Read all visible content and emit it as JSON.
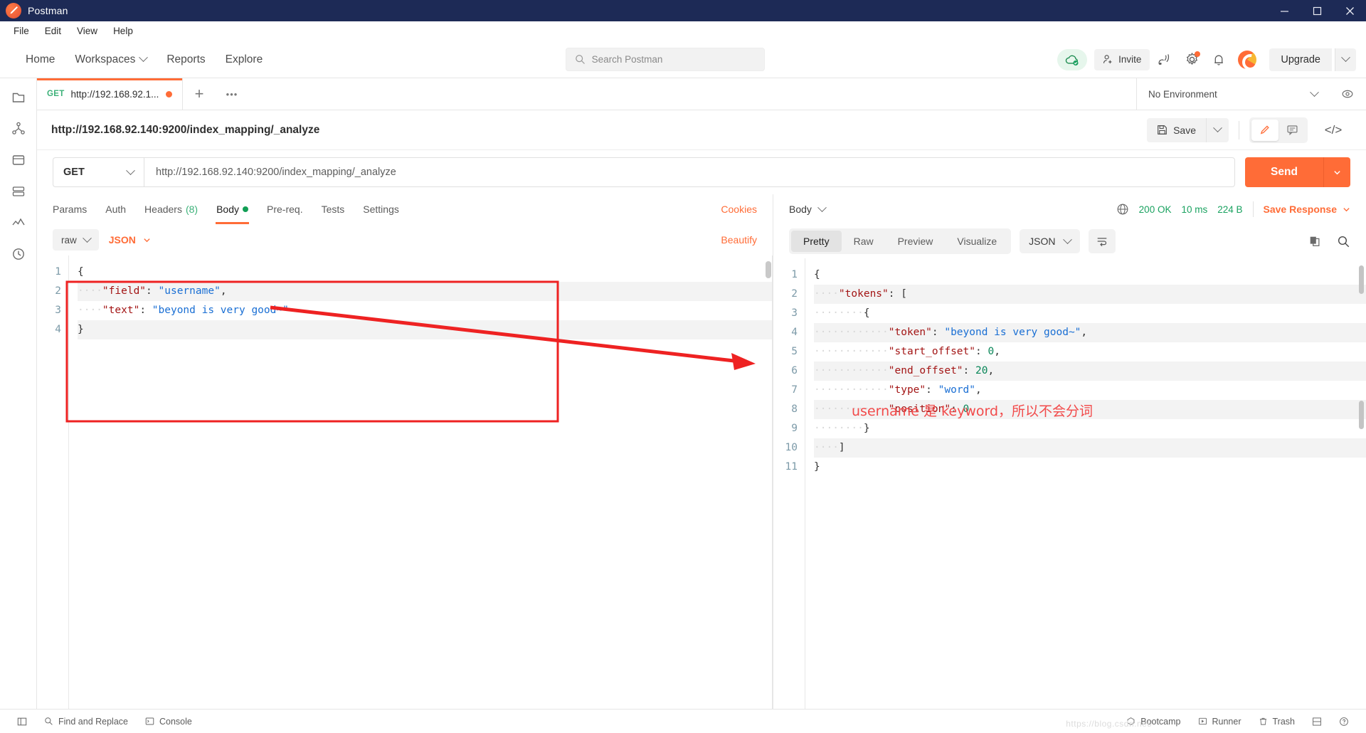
{
  "window": {
    "app_title": "Postman",
    "logo_icon": "postman-logo-icon",
    "minimize_label": "–",
    "maximize_label": "❐",
    "close_label": "✕"
  },
  "menubar": {
    "items": [
      "File",
      "Edit",
      "View",
      "Help"
    ]
  },
  "topnav": {
    "items": [
      {
        "label": "Home",
        "has_caret": false
      },
      {
        "label": "Workspaces",
        "has_caret": true
      },
      {
        "label": "Reports",
        "has_caret": false
      },
      {
        "label": "Explore",
        "has_caret": false
      }
    ],
    "search": {
      "placeholder": "Search Postman",
      "icon": "search-icon"
    },
    "cloud_icon": "cloud-sync-ok-icon",
    "invite_label": "Invite",
    "invite_icon": "person-add-icon",
    "satellite_icon": "satellite-antenna-icon",
    "settings_icon": "gear-icon",
    "notifications_icon": "bell-icon",
    "avatar_icon": "user-avatar-icon",
    "upgrade_label": "Upgrade",
    "upgrade_caret": "chevron-down-icon"
  },
  "rail": {
    "items": [
      "collections-icon",
      "apis-icon",
      "environments-icon",
      "mock-servers-icon",
      "monitors-icon",
      "history-icon"
    ]
  },
  "tabstrip": {
    "tabs": [
      {
        "method": "GET",
        "name": "http://192.168.92.1...",
        "unsaved": true
      }
    ],
    "add_label": "+",
    "more_label": "•••",
    "environment": {
      "value": "No Environment",
      "caret": "chevron-down-icon",
      "eye_icon": "eye-icon"
    }
  },
  "request_header": {
    "title": "http://192.168.92.140:9200/index_mapping/_analyze",
    "save_label": "Save",
    "save_icon": "floppy-disk-icon",
    "save_caret": "chevron-down-icon",
    "edit_icon": "pencil-icon",
    "comment_icon": "comment-icon",
    "code_icon": "code-brackets-icon"
  },
  "url_row": {
    "method": "GET",
    "method_caret": "chevron-down-icon",
    "url": "http://192.168.92.140:9200/index_mapping/_analyze",
    "send_label": "Send",
    "send_caret": "chevron-down-icon"
  },
  "request_tabs": {
    "tabs": [
      {
        "label": "Params",
        "active": false
      },
      {
        "label": "Auth",
        "active": false
      },
      {
        "label": "Headers",
        "count": "(8)",
        "active": false
      },
      {
        "label": "Body",
        "dot": true,
        "active": true
      },
      {
        "label": "Pre-req.",
        "active": false
      },
      {
        "label": "Tests",
        "active": false
      },
      {
        "label": "Settings",
        "active": false
      }
    ],
    "cookies_label": "Cookies"
  },
  "body_bar": {
    "mode": "raw",
    "mode_caret": "chevron-down-icon",
    "format": "JSON",
    "format_caret": "chevron-down-icon",
    "beautify_label": "Beautify"
  },
  "request_body": {
    "line_numbers": [
      "1",
      "2",
      "3",
      "4"
    ],
    "lines": [
      [
        {
          "t": "{",
          "c": "p"
        }
      ],
      [
        {
          "t": "····",
          "c": "ind"
        },
        {
          "t": "\"field\"",
          "c": "k"
        },
        {
          "t": ": ",
          "c": "p"
        },
        {
          "t": "\"username\"",
          "c": "s"
        },
        {
          "t": ",",
          "c": "p"
        }
      ],
      [
        {
          "t": "····",
          "c": "ind"
        },
        {
          "t": "\"text\"",
          "c": "k"
        },
        {
          "t": ": ",
          "c": "p"
        },
        {
          "t": "\"beyond is very good~\"",
          "c": "s"
        }
      ],
      [
        {
          "t": "}",
          "c": "p"
        }
      ]
    ]
  },
  "response_header": {
    "body_label": "Body",
    "body_caret": "chevron-down-icon",
    "globe_icon": "globe-icon",
    "status": "200 OK",
    "time": "10 ms",
    "size": "224 B",
    "save_response_label": "Save Response",
    "save_response_caret": "chevron-down-icon"
  },
  "response_tabs": {
    "pills": [
      {
        "label": "Pretty",
        "active": true
      },
      {
        "label": "Raw",
        "active": false
      },
      {
        "label": "Preview",
        "active": false
      },
      {
        "label": "Visualize",
        "active": false
      }
    ],
    "format": "JSON",
    "format_caret": "chevron-down-icon",
    "wrap_icon": "word-wrap-icon",
    "copy_icon": "copy-icon",
    "search_icon": "search-icon"
  },
  "response_body": {
    "line_numbers": [
      "1",
      "2",
      "3",
      "4",
      "5",
      "6",
      "7",
      "8",
      "9",
      "10",
      "11"
    ],
    "lines": [
      [
        {
          "t": "{",
          "c": "p"
        }
      ],
      [
        {
          "t": "····",
          "c": "ind"
        },
        {
          "t": "\"tokens\"",
          "c": "k"
        },
        {
          "t": ": [",
          "c": "p"
        }
      ],
      [
        {
          "t": "········",
          "c": "ind"
        },
        {
          "t": "{",
          "c": "p"
        }
      ],
      [
        {
          "t": "············",
          "c": "ind"
        },
        {
          "t": "\"token\"",
          "c": "k"
        },
        {
          "t": ": ",
          "c": "p"
        },
        {
          "t": "\"beyond is very good~\"",
          "c": "s"
        },
        {
          "t": ",",
          "c": "p"
        }
      ],
      [
        {
          "t": "············",
          "c": "ind"
        },
        {
          "t": "\"start_offset\"",
          "c": "k"
        },
        {
          "t": ": ",
          "c": "p"
        },
        {
          "t": "0",
          "c": "n"
        },
        {
          "t": ",",
          "c": "p"
        }
      ],
      [
        {
          "t": "············",
          "c": "ind"
        },
        {
          "t": "\"end_offset\"",
          "c": "k"
        },
        {
          "t": ": ",
          "c": "p"
        },
        {
          "t": "20",
          "c": "n"
        },
        {
          "t": ",",
          "c": "p"
        }
      ],
      [
        {
          "t": "············",
          "c": "ind"
        },
        {
          "t": "\"type\"",
          "c": "k"
        },
        {
          "t": ": ",
          "c": "p"
        },
        {
          "t": "\"word\"",
          "c": "s"
        },
        {
          "t": ",",
          "c": "p"
        }
      ],
      [
        {
          "t": "············",
          "c": "ind"
        },
        {
          "t": "\"position\"",
          "c": "k"
        },
        {
          "t": ": ",
          "c": "p"
        },
        {
          "t": "0",
          "c": "n"
        }
      ],
      [
        {
          "t": "········",
          "c": "ind"
        },
        {
          "t": "}",
          "c": "p"
        }
      ],
      [
        {
          "t": "····",
          "c": "ind"
        },
        {
          "t": "]",
          "c": "p"
        }
      ],
      [
        {
          "t": "}",
          "c": "p"
        }
      ]
    ]
  },
  "annotation": {
    "note": "username 是 keyword，所以不会分词",
    "color": "#f24a4a"
  },
  "statusbar": {
    "left": [
      {
        "label": "",
        "icon": "sidebar-toggle-icon"
      },
      {
        "label": "Find and Replace",
        "icon": "search-icon"
      },
      {
        "label": "Console",
        "icon": "terminal-icon"
      }
    ],
    "right": [
      {
        "label": "Bootcamp",
        "icon": "bootcamp-icon"
      },
      {
        "label": "Runner",
        "icon": "runner-icon"
      },
      {
        "label": "Trash",
        "icon": "trash-icon"
      },
      {
        "label": "",
        "icon": "layout-icon"
      },
      {
        "label": "",
        "icon": "help-icon"
      }
    ],
    "watermark": "https://blog.csdn.net/"
  }
}
